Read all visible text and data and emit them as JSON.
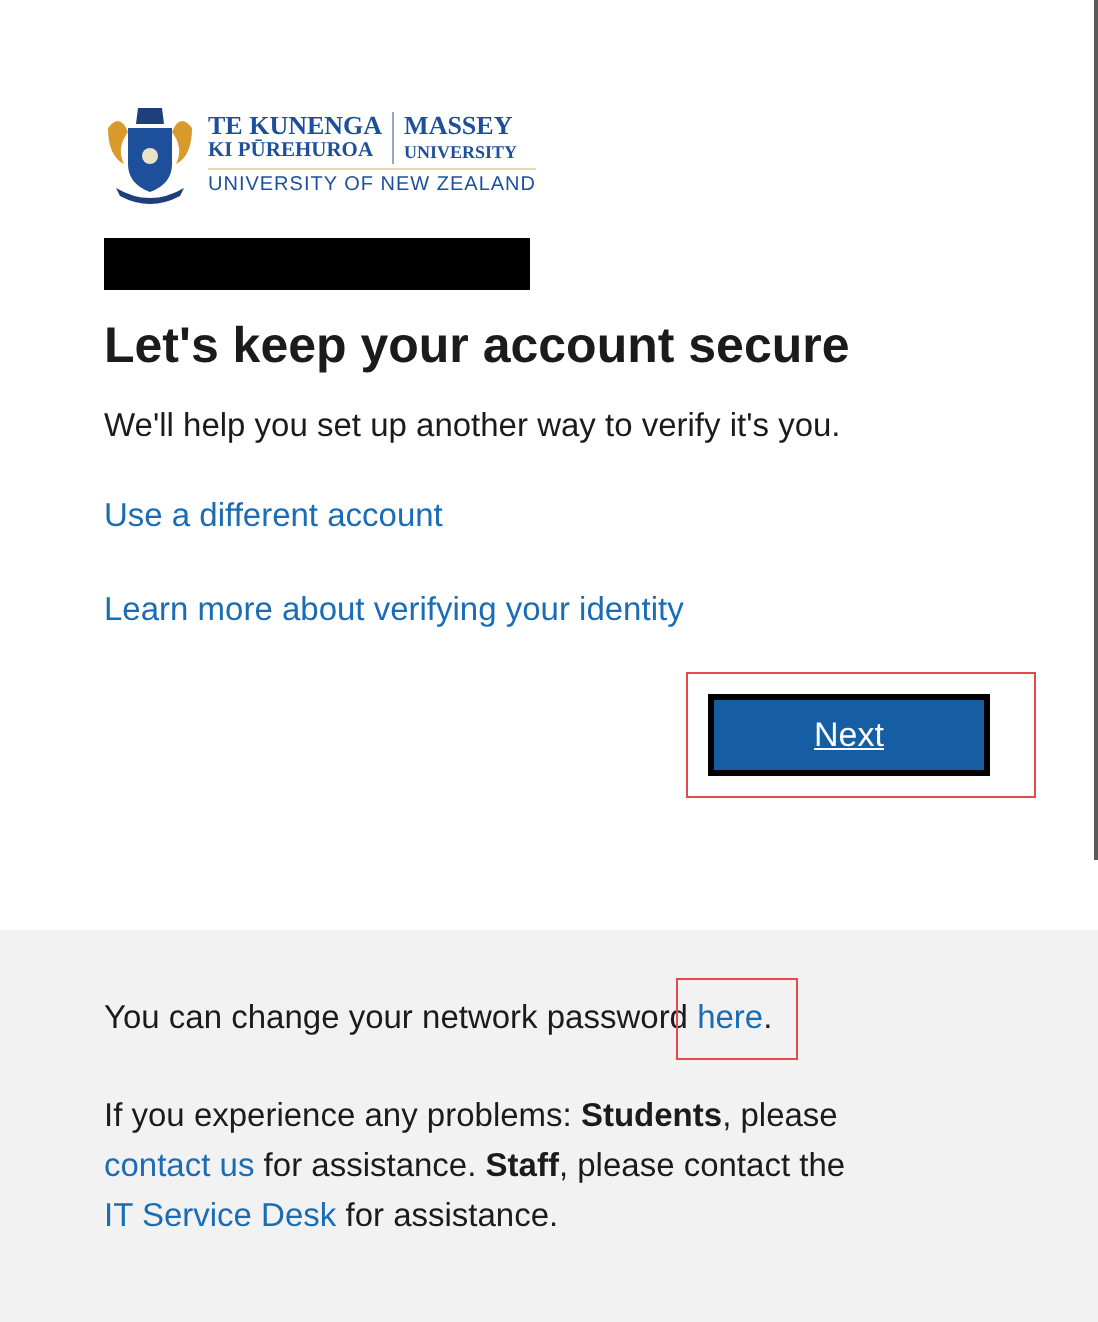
{
  "logo": {
    "maori_name": [
      "TE KUNENGA",
      "KI PŪREHUROA"
    ],
    "english_name": [
      "MASSEY",
      "UNIVERSITY"
    ],
    "tagline": "UNIVERSITY OF NEW ZEALAND"
  },
  "redacted": true,
  "heading": "Let's keep your account secure",
  "description": "We'll help you set up another way to verify it's you.",
  "links": [
    "Use a different account",
    "Learn more about verifying your identity"
  ],
  "next_button": {
    "label": "Next",
    "highlighted": true
  },
  "footer": {
    "paragraphs": [
      [
        {
          "kind": "text",
          "text": "You can change your network password "
        },
        {
          "kind": "link",
          "text": "here",
          "highlighted": true
        },
        {
          "kind": "text",
          "text": "."
        }
      ],
      [
        {
          "kind": "text",
          "text": "If you experience any problems: "
        },
        {
          "kind": "bold",
          "text": "Students"
        },
        {
          "kind": "text",
          "text": ", please "
        },
        {
          "kind": "link",
          "text": "contact us",
          "highlighted": false
        },
        {
          "kind": "text",
          "text": " for assistance. "
        },
        {
          "kind": "bold",
          "text": "Staff"
        },
        {
          "kind": "text",
          "text": ", please contact the "
        },
        {
          "kind": "link",
          "text": "IT Service Desk",
          "highlighted": false
        },
        {
          "kind": "text",
          "text": " for assistance."
        }
      ]
    ]
  }
}
